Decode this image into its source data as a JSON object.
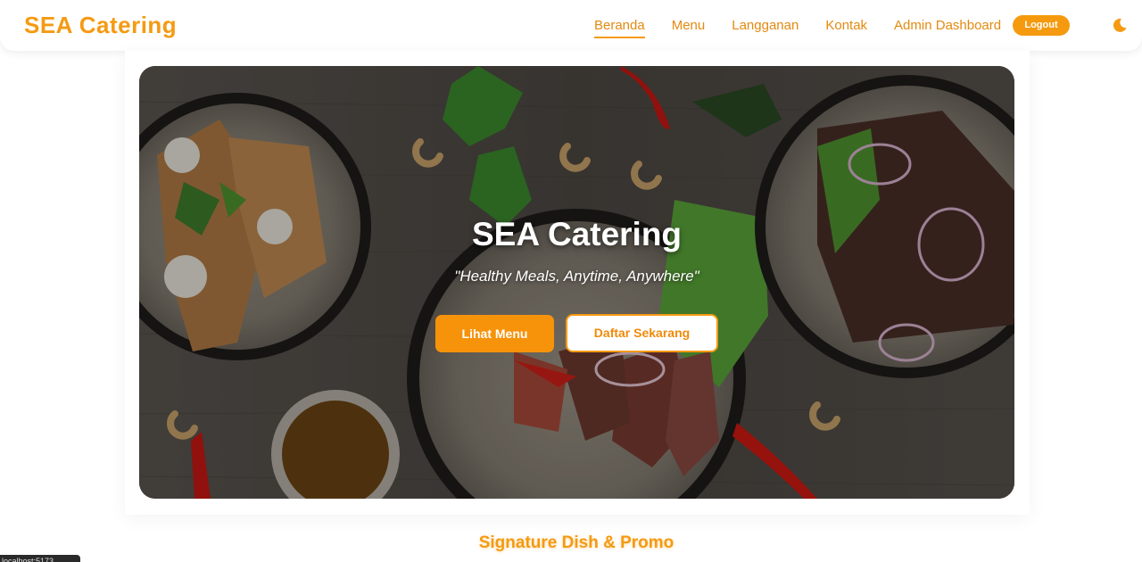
{
  "header": {
    "brand": "SEA Catering",
    "nav": [
      {
        "label": "Beranda",
        "active": true
      },
      {
        "label": "Menu",
        "active": false
      },
      {
        "label": "Langganan",
        "active": false
      },
      {
        "label": "Kontak",
        "active": false
      },
      {
        "label": "Admin Dashboard",
        "active": false
      }
    ],
    "logout_label": "Logout",
    "theme_toggle_icon": "moon-icon"
  },
  "hero": {
    "title": "SEA Catering",
    "tagline": "\"Healthy Meals, Anytime, Anywhere\"",
    "primary_button": "Lihat Menu",
    "secondary_button": "Daftar Sekarang"
  },
  "section": {
    "title": "Signature Dish & Promo"
  },
  "statusbar": {
    "text": "localhost:5173"
  },
  "colors": {
    "accent": "#f59a12",
    "accent_dark": "#e38a10",
    "button_primary": "#f7930a"
  }
}
